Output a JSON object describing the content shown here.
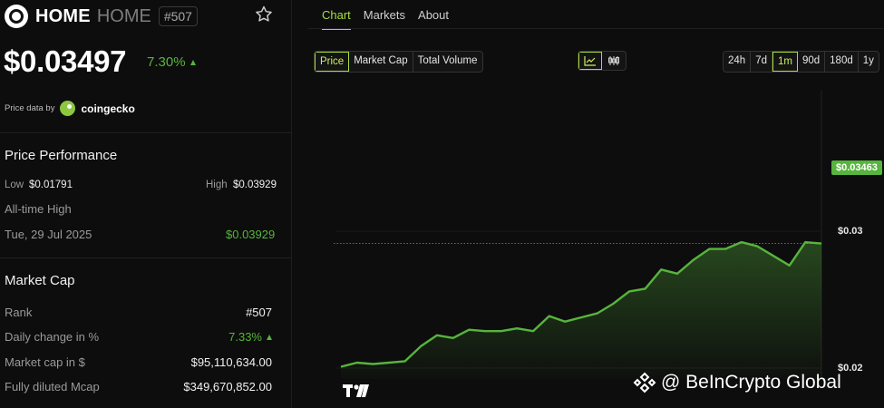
{
  "coin": {
    "symbol": "HOME",
    "name": "HOME",
    "rank_badge": "#507",
    "price": "$0.03497",
    "change": "7.30%",
    "price_data_label": "Price data by",
    "provider": "coingecko"
  },
  "performance": {
    "title": "Price Performance",
    "low_label": "Low",
    "low_value": "$0.01791",
    "high_label": "High",
    "high_value": "$0.03929",
    "ath_label": "All-time High",
    "ath_date": "Tue, 29 Jul 2025",
    "ath_value": "$0.03929"
  },
  "market_cap": {
    "title": "Market Cap",
    "rows": [
      {
        "label": "Rank",
        "value": "#507"
      },
      {
        "label": "Daily change in %",
        "value": "7.33%"
      },
      {
        "label": "Market cap in $",
        "value": "$95,110,634.00"
      },
      {
        "label": "Fully diluted Mcap",
        "value": "$349,670,852.00"
      }
    ]
  },
  "tabs": [
    "Chart",
    "Markets",
    "About"
  ],
  "metric_buttons": [
    "Price",
    "Market Cap",
    "Total Volume"
  ],
  "range_buttons": [
    "24h",
    "7d",
    "1m",
    "90d",
    "180d",
    "1y"
  ],
  "colors": {
    "accent": "#a6dd40",
    "up": "#57b43d"
  },
  "chart_data": {
    "type": "area",
    "x": [
      1,
      2,
      3,
      4,
      5,
      6,
      7,
      8,
      9,
      10,
      11,
      12,
      13,
      14,
      15,
      16,
      17,
      18,
      19,
      20,
      21,
      22,
      23,
      24,
      25,
      26,
      27,
      28,
      29,
      30,
      31
    ],
    "values": [
      0.0201,
      0.0204,
      0.0203,
      0.0204,
      0.0205,
      0.0216,
      0.0224,
      0.0222,
      0.0228,
      0.0227,
      0.0227,
      0.0229,
      0.0227,
      0.0238,
      0.0234,
      0.0237,
      0.024,
      0.0247,
      0.0256,
      0.0258,
      0.0272,
      0.0269,
      0.0279,
      0.0287,
      0.0287,
      0.0292,
      0.0289,
      0.0282,
      0.0275,
      0.0292,
      0.0291
    ],
    "current_price": "$0.03463",
    "y_ticks": [
      "$0.03",
      "$0.02"
    ],
    "ylim": [
      0.0199,
      0.03
    ]
  }
}
